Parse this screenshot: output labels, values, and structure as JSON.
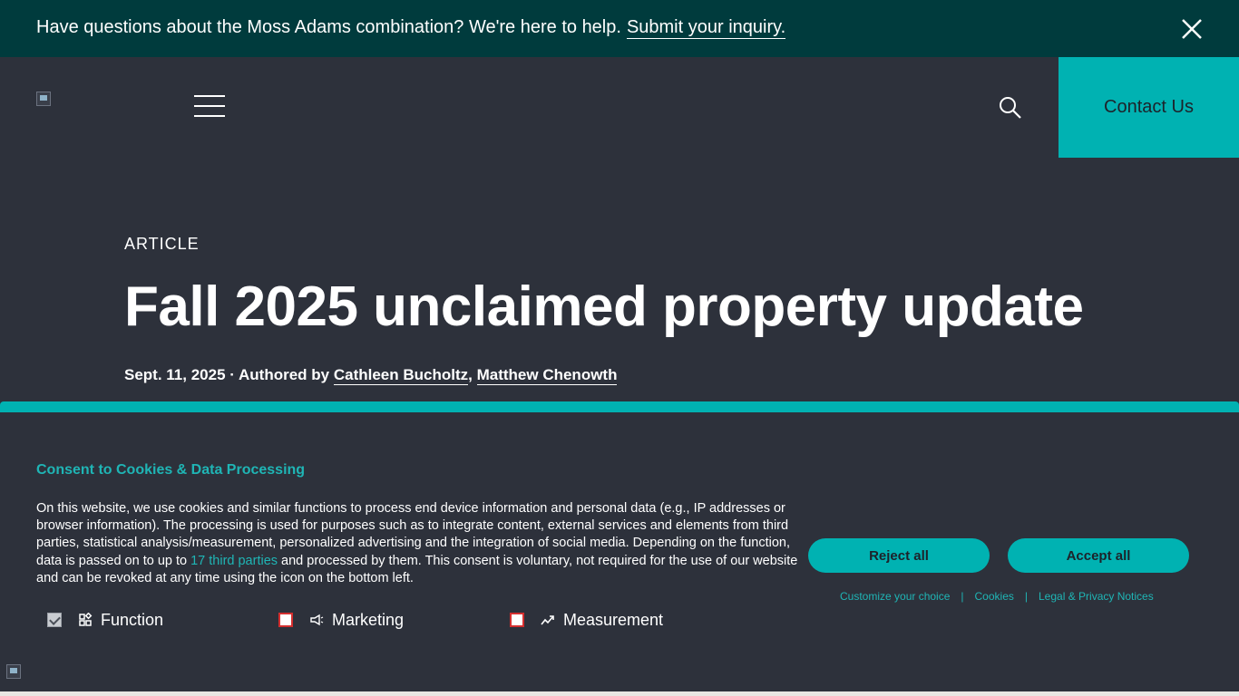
{
  "announcement": {
    "text": "Have questions about the Moss Adams combination? We're here to help.",
    "link_label": "Submit your inquiry."
  },
  "header": {
    "contact_label": "Contact Us"
  },
  "article": {
    "eyebrow": "ARTICLE",
    "title": "Fall 2025 unclaimed property update",
    "date": "Sept. 11, 2025",
    "separator": " · Authored by ",
    "authors": [
      "Cathleen Bucholtz",
      "Matthew Chenowth"
    ],
    "author_sep": ", "
  },
  "cookie": {
    "title": "Consent to Cookies & Data Processing",
    "body_part1": "On this website, we use cookies and similar functions to process end device information and personal data (e.g., IP addresses or browser information). The processing is used for purposes such as to integrate content, external services and elements from third parties, statistical analysis/measurement, personalized advertising and the integration of social media. Depending on the function, data is passed on to up to ",
    "third_parties_link": "17 third parties",
    "body_part2": " and processed by them. This consent is voluntary, not required for the use of our website and can be revoked at any time using the icon on the bottom left.",
    "categories": [
      {
        "label": "Function",
        "checked": true,
        "icon": "function-icon"
      },
      {
        "label": "Marketing",
        "checked": false,
        "icon": "megaphone-icon"
      },
      {
        "label": "Measurement",
        "checked": false,
        "icon": "chart-trend-icon"
      }
    ],
    "reject_label": "Reject all",
    "accept_label": "Accept all",
    "links": [
      "Customize your choice",
      "Cookies",
      "Legal & Privacy Notices"
    ],
    "link_separator": "|"
  },
  "colors": {
    "accent": "#00b2b2",
    "announce_bg": "#003b3d",
    "page_bg": "#2d313b"
  }
}
